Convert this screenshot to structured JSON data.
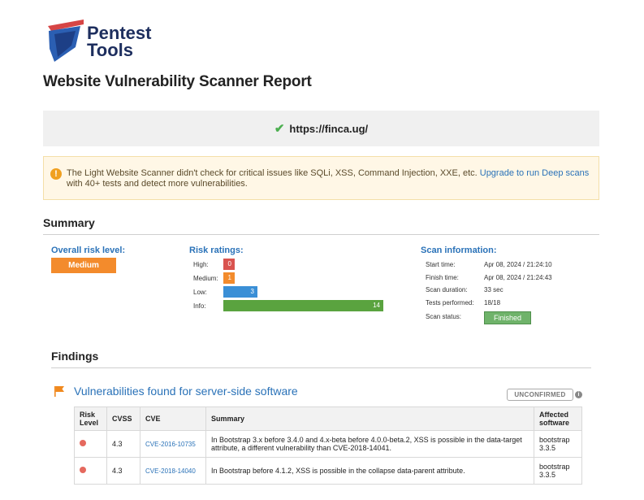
{
  "brand": {
    "line1": "Pentest",
    "line2": "Tools"
  },
  "page_title": "Website Vulnerability Scanner Report",
  "target": {
    "url": "https://finca.ug/"
  },
  "notice": {
    "text": "The Light Website Scanner didn't check for critical issues like SQLi, XSS, Command Injection, XXE, etc.",
    "link_text": "Upgrade to run Deep scans",
    "text_after": "with 40+ tests and detect more vulnerabilities."
  },
  "summary": {
    "heading": "Summary",
    "overall_label": "Overall risk level:",
    "overall_value": "Medium",
    "risk_label": "Risk ratings:",
    "ratings": [
      {
        "label": "High:",
        "count": "0",
        "value": 0,
        "color": "#d9534f"
      },
      {
        "label": "Medium:",
        "count": "1",
        "value": 1,
        "color": "#f38b2c"
      },
      {
        "label": "Low:",
        "count": "3",
        "value": 3,
        "color": "#3a8fd6"
      },
      {
        "label": "Info:",
        "count": "14",
        "value": 14,
        "color": "#5aa33f"
      }
    ],
    "scan_label": "Scan information:",
    "scan_info": [
      {
        "key": "Start time:",
        "value": "Apr 08, 2024 / 21:24:10"
      },
      {
        "key": "Finish time:",
        "value": "Apr 08, 2024 / 21:24:43"
      },
      {
        "key": "Scan duration:",
        "value": "33 sec"
      },
      {
        "key": "Tests performed:",
        "value": "18/18"
      },
      {
        "key": "Scan status:",
        "value": "Finished"
      }
    ]
  },
  "findings": {
    "heading": "Findings",
    "section_title": "Vulnerabilities found for server-side software",
    "badge": "UNCONFIRMED",
    "columns": [
      "Risk Level",
      "CVSS",
      "CVE",
      "Summary",
      "Affected software"
    ],
    "rows": [
      {
        "cvss": "4.3",
        "cve": "CVE-2016-10735",
        "summary": "In Bootstrap 3.x before 3.4.0 and 4.x-beta before 4.0.0-beta.2, XSS is possible in the data-target attribute, a different vulnerability than CVE-2018-14041.",
        "software": "bootstrap 3.3.5"
      },
      {
        "cvss": "4.3",
        "cve": "CVE-2018-14040",
        "summary": "In Bootstrap before 4.1.2, XSS is possible in the collapse data-parent attribute.",
        "software": "bootstrap 3.3.5"
      }
    ]
  }
}
